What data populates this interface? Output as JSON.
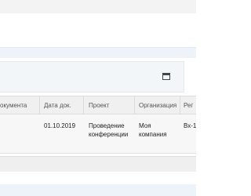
{
  "table": {
    "headers": [
      "окумента",
      "Дата док.",
      "Проект",
      "Организация",
      "Рег"
    ],
    "rows": [
      {
        "date": "01.10.2019",
        "project_line1": "Проведение",
        "project_line2": "конференции",
        "org_line1": "Моя",
        "org_line2": "компания",
        "reg": "Вх-1"
      }
    ]
  },
  "icons": {
    "panel_toggle": "window-icon"
  }
}
